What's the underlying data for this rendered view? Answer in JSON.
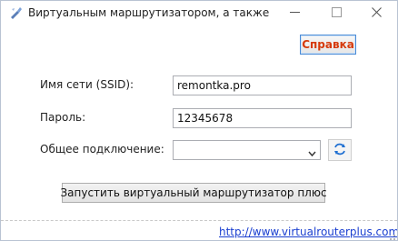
{
  "window": {
    "title": "Виртуальным маршрутизатором, а также",
    "controls": {
      "minimize": "minimize-icon",
      "maximize": "maximize-icon",
      "close": "close-icon"
    }
  },
  "toolbar": {
    "help_label": "Справка"
  },
  "form": {
    "ssid": {
      "label": "Имя сети (SSID):",
      "value": "remontka.pro"
    },
    "password": {
      "label": "Пароль:",
      "value": "12345678"
    },
    "connection": {
      "label": "Общее подключение:",
      "value": ""
    }
  },
  "actions": {
    "start_label": "Запустить виртуальный маршрутизатор плюс"
  },
  "status": {
    "link": "http://www.virtualrouterplus.com"
  },
  "colors": {
    "help_text": "#d63a0c",
    "link": "#1a3fd0",
    "accent_border": "#4a8bd6"
  }
}
